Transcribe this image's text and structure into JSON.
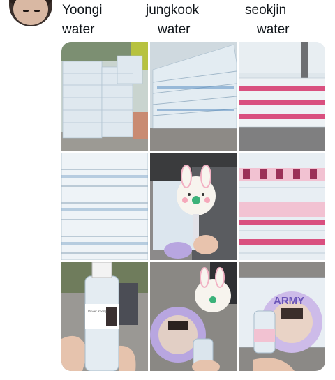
{
  "tweet": {
    "avatar_alt": "profile avatar",
    "caption": [
      {
        "name": "Yoongi",
        "item": "water"
      },
      {
        "name": "jungkook",
        "item": "water"
      },
      {
        "name": "seokjin",
        "item": "water"
      }
    ]
  },
  "photos": [
    {
      "scene": "stacked-water-pallets"
    },
    {
      "scene": "stacked-water-pallets"
    },
    {
      "scene": "pink-label-water-pallets"
    },
    {
      "scene": "water-shelf-rows"
    },
    {
      "scene": "bunny-fan-in-hand"
    },
    {
      "scene": "pink-photo-label-bottles"
    },
    {
      "scene": "hand-holding-bottle"
    },
    {
      "scene": "bunny-and-photo-fans"
    },
    {
      "scene": "army-fan-with-bottle"
    }
  ],
  "photo_text": {
    "bottle_label": "Yoongi",
    "bottle_label_script": "Power Yoongi",
    "fan_text": "ARMY"
  },
  "colors": {
    "water_blue": "#c7d8e6",
    "label_pink": "#d9507f",
    "ground": "#8a8580",
    "sky": "#d8e4ea",
    "fan_pink": "#f2b2c4",
    "fan_purple": "#b8a6e0"
  }
}
